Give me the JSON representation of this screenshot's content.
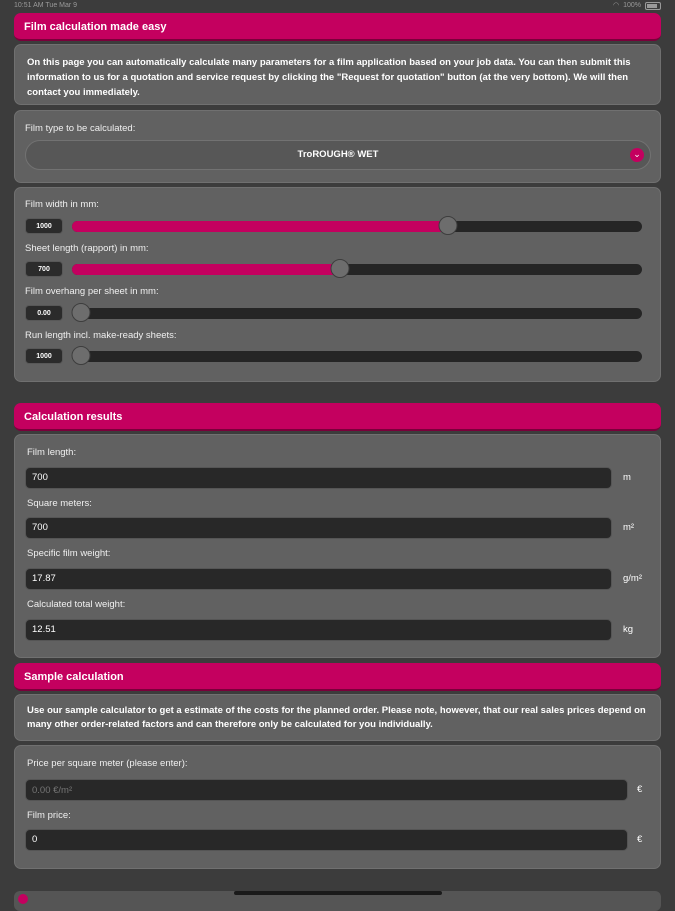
{
  "status_bar": {
    "time": "10:51 AM",
    "date": "Tue Mar 9",
    "battery": "100%"
  },
  "header_film": {
    "title": "Film calculation made easy"
  },
  "intro": {
    "text": "On this page you can automatically calculate many parameters for a film application based on your job data. You can then submit this information to us for a quotation and service request by clicking the \"Request for quotation\" button (at the very bottom). We will then contact you immediately."
  },
  "film_type": {
    "label": "Film type to be calculated:",
    "value": "TroROUGH® WET",
    "icon": "chevron-down-icon"
  },
  "sliders": [
    {
      "label": "Film width in mm:",
      "value": "1000",
      "fraction": 0.66
    },
    {
      "label": "Sheet length (rapport) in mm:",
      "value": "700",
      "fraction": 0.47
    },
    {
      "label": "Film overhang per sheet in mm:",
      "value": "0.00",
      "fraction": 0.0
    },
    {
      "label": "Run length incl. make-ready sheets:",
      "value": "1000",
      "fraction": 0.01
    }
  ],
  "header_results": {
    "title": "Calculation results"
  },
  "results": [
    {
      "label": "Film length:",
      "value": "700",
      "unit": "m"
    },
    {
      "label": "Square meters:",
      "value": "700",
      "unit": "m²"
    },
    {
      "label": "Specific film weight:",
      "value": "17.87",
      "unit": "g/m²"
    },
    {
      "label": "Calculated total weight:",
      "value": "12.51",
      "unit": "kg"
    }
  ],
  "header_sample": {
    "title": "Sample calculation"
  },
  "sample_intro": {
    "text": "Use our sample calculator to get a estimate of the costs for the planned order. Please note, however, that our real sales prices depend on many other order-related factors and can therefore only be calculated for you individually."
  },
  "sample": {
    "price_label": "Price per square meter (please enter):",
    "price_placeholder": "0.00 €/m²",
    "price_unit": "€",
    "film_price_label": "Film price:",
    "film_price_value": "0",
    "film_price_unit": "€"
  },
  "colors": {
    "accent": "#c4005f",
    "background": "#3c3c3c",
    "panel": "#616161"
  }
}
